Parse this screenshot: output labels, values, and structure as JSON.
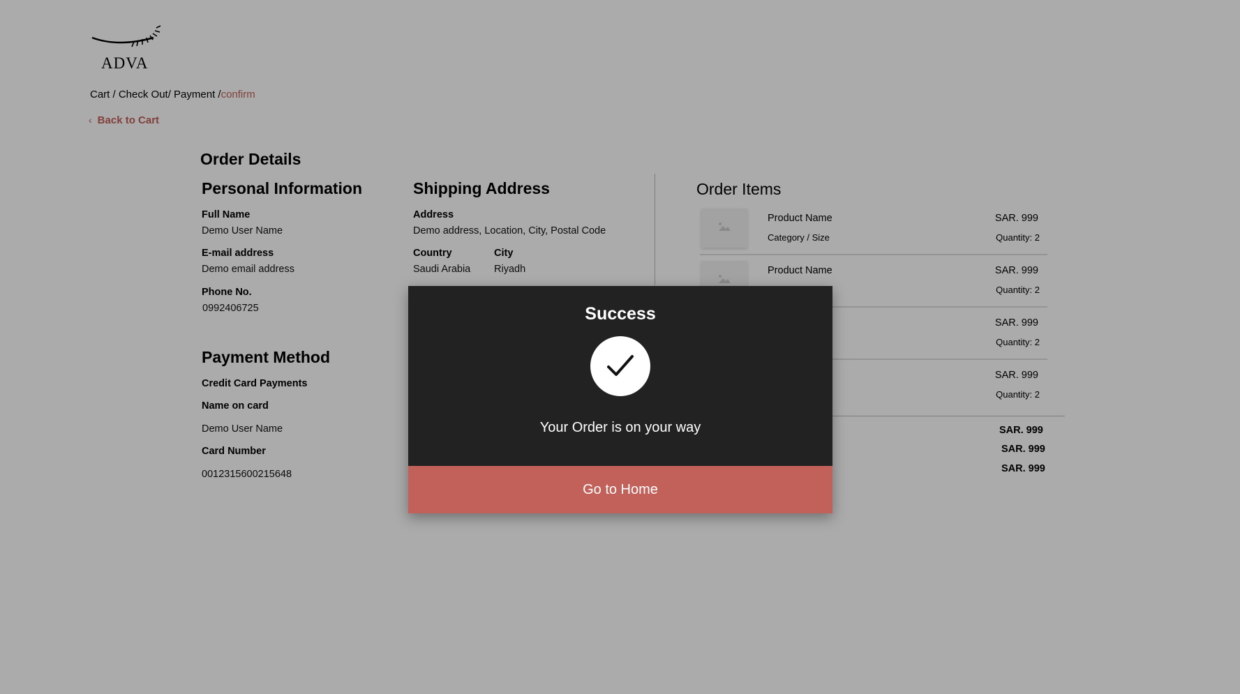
{
  "brand": {
    "name": "ADVA"
  },
  "breadcrumb": {
    "path": "Cart / Check Out/ Payment /",
    "active": "confirm"
  },
  "back_link": {
    "label": "Back to Cart"
  },
  "order": {
    "title": "Order Details",
    "personal": {
      "heading": "Personal Information",
      "full_name_label": "Full Name",
      "full_name": "Demo User Name",
      "email_label": "E-mail address",
      "email": "Demo email address",
      "phone_label": "Phone No.",
      "phone": "0992406725"
    },
    "shipping": {
      "heading": "Shipping Address",
      "address_label": "Address",
      "address": "Demo address, Location, City, Postal Code",
      "country_label": "Country",
      "country": "Saudi Arabia",
      "city_label": "City",
      "city": "Riyadh"
    },
    "payment": {
      "heading": "Payment Method",
      "method": "Credit Card Payments",
      "name_label": "Name on card",
      "name": "Demo User Name",
      "card_label": "Card Number",
      "card": "0012315600215648"
    }
  },
  "items": {
    "heading": "Order Items",
    "list": [
      {
        "name": "Product Name",
        "category": "Category / Size",
        "price": "SAR. 999",
        "quantity": "Quantity: 2"
      },
      {
        "name": "Product Name",
        "category": "",
        "price": "SAR. 999",
        "quantity": "Quantity: 2"
      },
      {
        "name": "",
        "category": "",
        "price": "SAR. 999",
        "quantity": "Quantity: 2"
      },
      {
        "name": "",
        "category": "",
        "price": "SAR. 999",
        "quantity": "Quantity: 2"
      }
    ],
    "totals": [
      "SAR. 999",
      "SAR. 999",
      "SAR. 999"
    ]
  },
  "modal": {
    "title": "Success",
    "message": "Your Order is on your way",
    "button": "Go to Home"
  },
  "colors": {
    "accent": "#c2605a",
    "modal_bg": "#222222",
    "overlay": "rgba(0,0,0,0.33)"
  }
}
